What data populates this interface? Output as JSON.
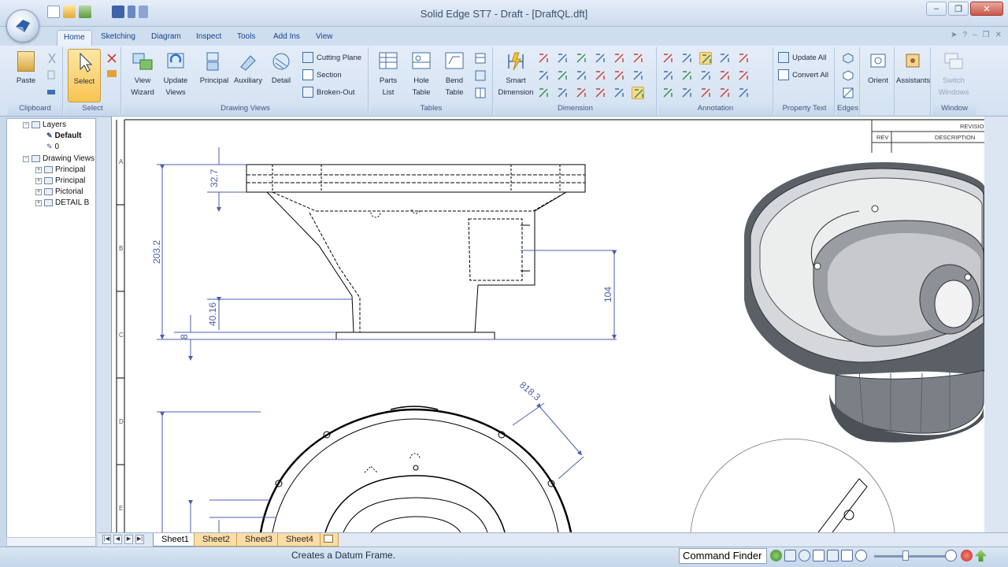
{
  "window": {
    "title": "Solid Edge ST7 - Draft - [DraftQL.dft]"
  },
  "tabs": [
    "Home",
    "Sketching",
    "Diagram",
    "Inspect",
    "Tools",
    "Add Ins",
    "View"
  ],
  "ribbon": {
    "clipboard": {
      "label": "Clipboard",
      "paste": "Paste"
    },
    "select": {
      "label": "Select",
      "select": "Select"
    },
    "drawing_views": {
      "label": "Drawing Views",
      "view_wizard": [
        "View",
        "Wizard"
      ],
      "update_views": [
        "Update",
        "Views"
      ],
      "principal": "Principal",
      "auxiliary": "Auxiliary",
      "detail": "Detail",
      "cutting_plane": "Cutting Plane",
      "section": "Section",
      "broken_out": "Broken-Out"
    },
    "tables": {
      "label": "Tables",
      "parts_list": [
        "Parts",
        "List"
      ],
      "hole_table": [
        "Hole",
        "Table"
      ],
      "bend_table": [
        "Bend",
        "Table"
      ]
    },
    "dimension": {
      "label": "Dimension",
      "smart_dimension": [
        "Smart",
        "Dimension"
      ]
    },
    "annotation": {
      "label": "Annotation"
    },
    "property_text": {
      "label": "Property Text",
      "update_all": "Update All",
      "convert_all": "Convert All"
    },
    "edges": {
      "label": "Edges"
    },
    "orient": {
      "label": "Orient"
    },
    "assistants": {
      "label": "Assistants"
    },
    "window": {
      "label": "Window",
      "switch_windows": [
        "Switch",
        "Windows"
      ]
    }
  },
  "tree": {
    "items": [
      {
        "label": "Layers",
        "level": 1
      },
      {
        "label": "Default",
        "level": 2
      },
      {
        "label": "0",
        "level": 2
      },
      {
        "label": "Drawing Views",
        "level": 1
      },
      {
        "label": "Principal",
        "level": 2
      },
      {
        "label": "Principal",
        "level": 2
      },
      {
        "label": "Pictorial",
        "level": 2
      },
      {
        "label": "DETAIL B",
        "level": 2
      }
    ]
  },
  "drawing": {
    "border_letters": [
      "A",
      "B",
      "C",
      "D",
      "E"
    ],
    "title_block": {
      "revisions": "REVISION",
      "rev": "REV",
      "description": "DESCRIPTION"
    },
    "dimensions": {
      "flange_height": "32.7",
      "overall_height": "203.2",
      "boss_height": "104",
      "base_height": "40.16",
      "base_thickness": "8",
      "diagonal": "818.3"
    }
  },
  "sheets": {
    "tabs": [
      "Sheet1",
      "Sheet2",
      "Sheet3",
      "Sheet4"
    ],
    "active": "Sheet1"
  },
  "status": {
    "prompt": "Creates a Datum Frame.",
    "command_finder": "Command Finder"
  }
}
